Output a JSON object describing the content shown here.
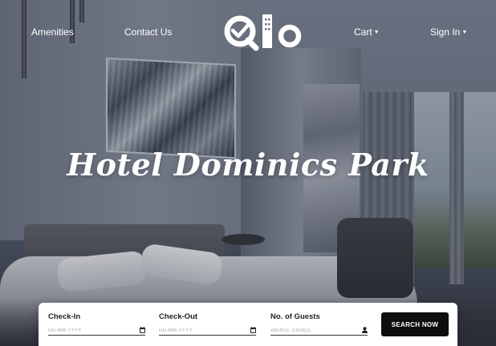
{
  "header": {
    "nav_left": [
      {
        "label": "Amenities"
      },
      {
        "label": "Contact Us"
      }
    ],
    "nav_right": [
      {
        "label": "Cart"
      },
      {
        "label": "Sign In"
      }
    ],
    "logo_text": "Qlo",
    "caret_icon": "caret-down-icon"
  },
  "hero": {
    "title": "Hotel Dominics Park"
  },
  "booking": {
    "check_in": {
      "label": "Check-In",
      "placeholder": "DD-MM-YYYY",
      "icon": "calendar-icon"
    },
    "check_out": {
      "label": "Check-Out",
      "placeholder": "DD-MM-YYYY",
      "icon": "calendar-icon"
    },
    "guests": {
      "label": "No. of Guests",
      "placeholder": "Adult(s), Child(s)",
      "icon": "user-icon"
    },
    "search_label": "SEARCH NOW"
  },
  "colors": {
    "button_bg": "#0e0e10",
    "nav_text": "#ffffff"
  }
}
